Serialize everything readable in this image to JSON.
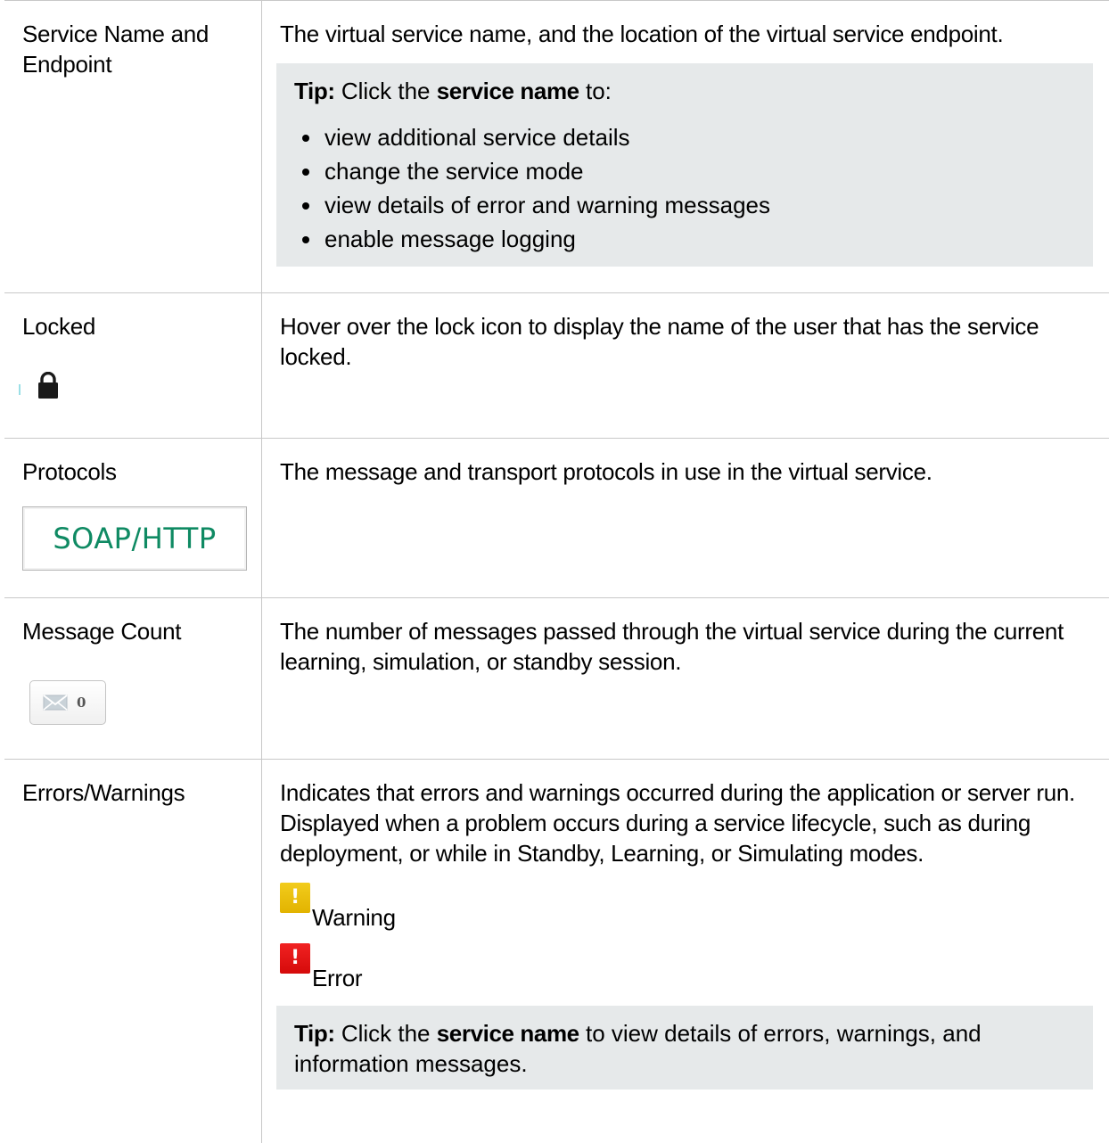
{
  "rows": [
    {
      "term": "Service Name and Endpoint",
      "description": "The virtual service name, and the location of the virtual service endpoint.",
      "tip": {
        "label": "Tip:",
        "pre": "Click the",
        "bold": "service name",
        "post": "to:",
        "bullets": [
          "view additional service details",
          "change the service mode",
          "view details of error and warning messages",
          "enable message logging"
        ]
      }
    },
    {
      "term": "Locked",
      "description": "Hover over the lock icon to display the name of the user that has the service locked.",
      "icon": "lock-icon"
    },
    {
      "term": "Protocols",
      "description": "The message and transport protocols in use in the virtual service.",
      "badge": "SOAP/HTTP"
    },
    {
      "term": "Message Count",
      "description": "The number of messages passed through the virtual service during the current learning, simulation, or standby session.",
      "icon": "envelope-icon",
      "count": "0"
    },
    {
      "term": "Errors/Warnings",
      "description": "Indicates that errors and warnings occurred during the application or server run. Displayed when a problem occurs during a service lifecycle, such as during deployment, or while in Standby, Learning, or Simulating modes.",
      "warning_label": "Warning",
      "error_label": "Error",
      "warning_glyph": "!",
      "error_glyph": "!",
      "tip": {
        "label": "Tip:",
        "pre": "Click the",
        "bold": "service name",
        "post": "to view details of errors, warnings, and information messages."
      }
    }
  ],
  "colors": {
    "border": "#c8c8c8",
    "tip_background": "#e6e9ea",
    "protocol_text": "#0f8a63",
    "warning": "#e8bd0a",
    "error": "#e41515"
  }
}
